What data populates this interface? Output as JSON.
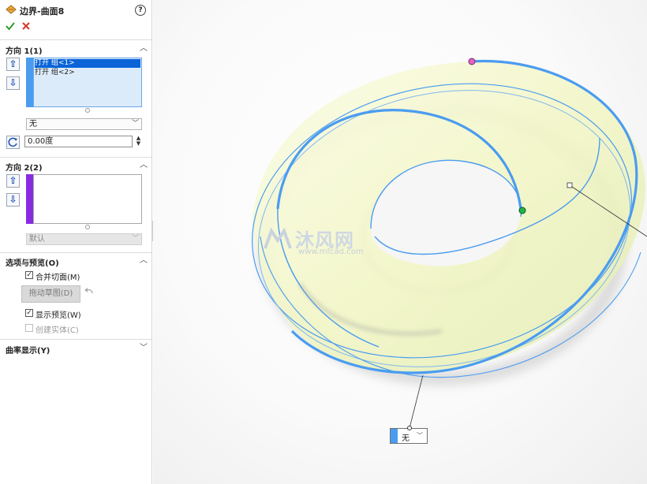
{
  "header": {
    "title": "边界-曲面8",
    "help_icon": "help-icon",
    "ok_icon": "check-icon",
    "cancel_icon": "x-icon"
  },
  "direction1": {
    "title": "方向 1(1)",
    "items": [
      "打开 组<1>",
      "打开 组<2>"
    ],
    "tangency": "无",
    "angle_value": "0.00度"
  },
  "direction2": {
    "title": "方向 2(2)",
    "tangency": "默认"
  },
  "options": {
    "title": "选项与预览(O)",
    "merge_faces": {
      "label": "合并切面(M)",
      "checked": true
    },
    "drag_sketch": "拖动草图(D)",
    "show_preview": {
      "label": "显示预览(W)",
      "checked": true
    },
    "create_solid": {
      "label": "创建实体(C)",
      "checked": false
    }
  },
  "curvature": {
    "title": "曲率显示(Y)"
  },
  "canvas": {
    "callout_value": "无",
    "watermark_text": "沐风网",
    "watermark_url": "www.mfcad.com"
  },
  "colors": {
    "accent": "#4a9cf0",
    "selection": "#0a64d8",
    "direction2_bar": "#8a2be2",
    "surface": "#f7f9d2"
  }
}
